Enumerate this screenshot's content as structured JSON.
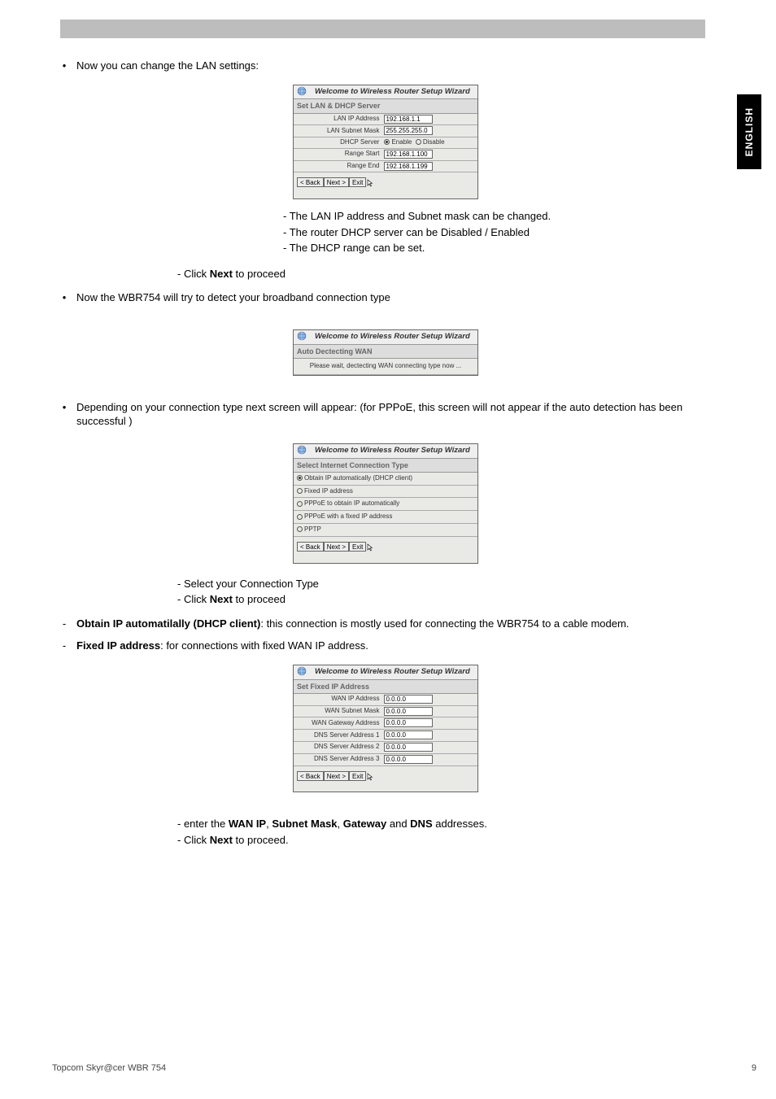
{
  "sidetab": "ENGLISH",
  "intro1": "Now you can change the LAN settings:",
  "wizard_header": "Welcome to Wireless Router Setup Wizard",
  "wiz1": {
    "sub": "Set LAN & DHCP Server",
    "rows": {
      "r1_label": "LAN IP Address",
      "r1_val": "192.168.1.1",
      "r2_label": "LAN Subnet Mask",
      "r2_val": "255.255.255.0",
      "r3_label": "DHCP Server",
      "r3_opt1": "Enable",
      "r3_opt2": "Disable",
      "r4_label": "Range Start",
      "r4_val": "192.168.1.100",
      "r5_label": "Range End",
      "r5_val": "192.168.1.199"
    }
  },
  "btn_back": "< Back",
  "btn_next": "Next >",
  "btn_exit": "Exit",
  "notes1": {
    "a": "- The LAN IP address and Subnet mask can be changed.",
    "b": "- The router DHCP server can be Disabled / Enabled",
    "c": "- The DHCP range can be set."
  },
  "click_next_pre": "- Click ",
  "click_next_bold": "Next",
  "click_next_post": " to proceed",
  "click_next_post2": " to proceed.",
  "intro2": "Now the WBR754 will try to detect your broadband connection type",
  "wiz2": {
    "sub": "Auto Dectecting WAN",
    "msg": "Please wait, dectecting WAN connecting type now ..."
  },
  "intro3": "Depending on your connection type next screen will appear: (for PPPoE, this screen will not appear if the auto detection has been successful )",
  "wiz3": {
    "sub": "Select Internet Connection Type",
    "o1": "Obtain IP automatically (DHCP client)",
    "o2": "Fixed IP address",
    "o3": "PPPoE to obtain IP automatically",
    "o4": "PPPoE with a fixed IP address",
    "o5": "PPTP"
  },
  "sel_line": "- Select your Connection Type",
  "dash_obtain_pre": "Obtain IP automatilally (DHCP client)",
  "dash_obtain_post": ": this connection is mostly used for connecting the WBR754 to a cable modem.",
  "dash_fixed_pre": "Fixed IP address",
  "dash_fixed_post": ": for connections with fixed WAN IP address.",
  "wiz4": {
    "sub": "Set Fixed IP Address",
    "r1_label": "WAN IP Address",
    "r1_val": "0.0.0.0",
    "r2_label": "WAN Subnet Mask",
    "r2_val": "0.0.0.0",
    "r3_label": "WAN Gateway Address",
    "r3_val": "0.0.0.0",
    "r4_label": "DNS Server Address 1",
    "r4_val": "0.0.0.0",
    "r5_label": "DNS Server Address 2",
    "r5_val": "0.0.0.0",
    "r6_label": "DNS Server Address 3",
    "r6_val": "0.0.0.0"
  },
  "enter_line_pre": "- enter the ",
  "enter_b1": "WAN IP",
  "enter_s1": ", ",
  "enter_b2": "Subnet Mask",
  "enter_s2": ", ",
  "enter_b3": "Gateway",
  "enter_s3": " and ",
  "enter_b4": "DNS",
  "enter_s4": " addresses.",
  "footer_left": "Topcom Skyr@cer WBR 754",
  "footer_right": "9"
}
